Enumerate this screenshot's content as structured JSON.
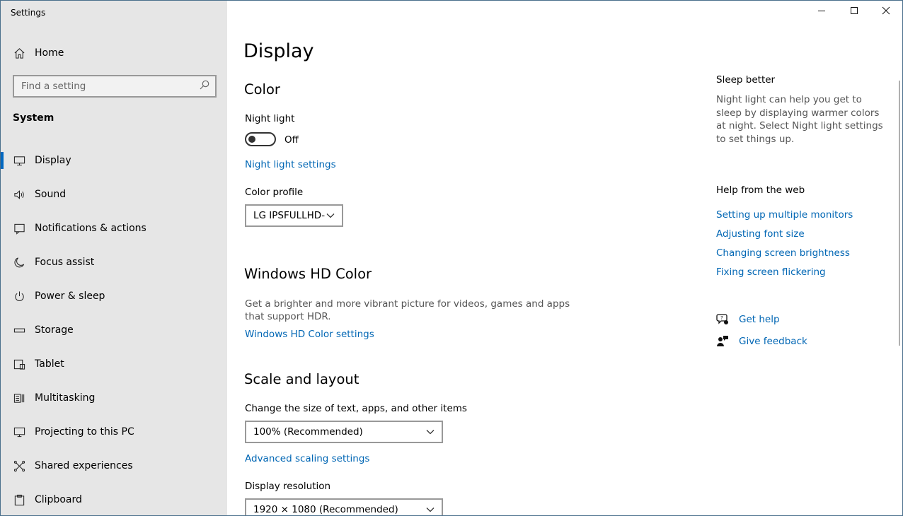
{
  "window": {
    "title": "Settings"
  },
  "sidebar": {
    "home_label": "Home",
    "search_placeholder": "Find a setting",
    "section_label": "System",
    "items": [
      {
        "label": "Display",
        "icon": "monitor-icon",
        "active": true
      },
      {
        "label": "Sound",
        "icon": "speaker-icon"
      },
      {
        "label": "Notifications & actions",
        "icon": "notification-icon"
      },
      {
        "label": "Focus assist",
        "icon": "moon-icon"
      },
      {
        "label": "Power & sleep",
        "icon": "power-icon"
      },
      {
        "label": "Storage",
        "icon": "storage-icon"
      },
      {
        "label": "Tablet",
        "icon": "tablet-icon"
      },
      {
        "label": "Multitasking",
        "icon": "multitasking-icon"
      },
      {
        "label": "Projecting to this PC",
        "icon": "projector-icon"
      },
      {
        "label": "Shared experiences",
        "icon": "share-icon"
      },
      {
        "label": "Clipboard",
        "icon": "clipboard-icon"
      }
    ]
  },
  "main": {
    "page_title": "Display",
    "color": {
      "heading": "Color",
      "night_light_label": "Night light",
      "night_light_state": "Off",
      "night_light_settings_link": "Night light settings",
      "color_profile_label": "Color profile",
      "color_profile_value": "LG IPSFULLHD-"
    },
    "hd_color": {
      "heading": "Windows HD Color",
      "description": "Get a brighter and more vibrant picture for videos, games and apps that support HDR.",
      "settings_link": "Windows HD Color settings"
    },
    "scale": {
      "heading": "Scale and layout",
      "size_label": "Change the size of text, apps, and other items",
      "size_value": "100% (Recommended)",
      "advanced_link": "Advanced scaling settings",
      "resolution_label": "Display resolution",
      "resolution_value": "1920 × 1080 (Recommended)"
    }
  },
  "right": {
    "sleep_heading": "Sleep better",
    "sleep_desc": "Night light can help you get to sleep by displaying warmer colors at night. Select Night light settings to set things up.",
    "web_heading": "Help from the web",
    "links": [
      "Setting up multiple monitors",
      "Adjusting font size",
      "Changing screen brightness",
      "Fixing screen flickering"
    ],
    "get_help": "Get help",
    "give_feedback": "Give feedback"
  },
  "colors": {
    "accent": "#0067c0",
    "link": "#0066b4",
    "sidebar_bg": "#e6e6e6"
  }
}
